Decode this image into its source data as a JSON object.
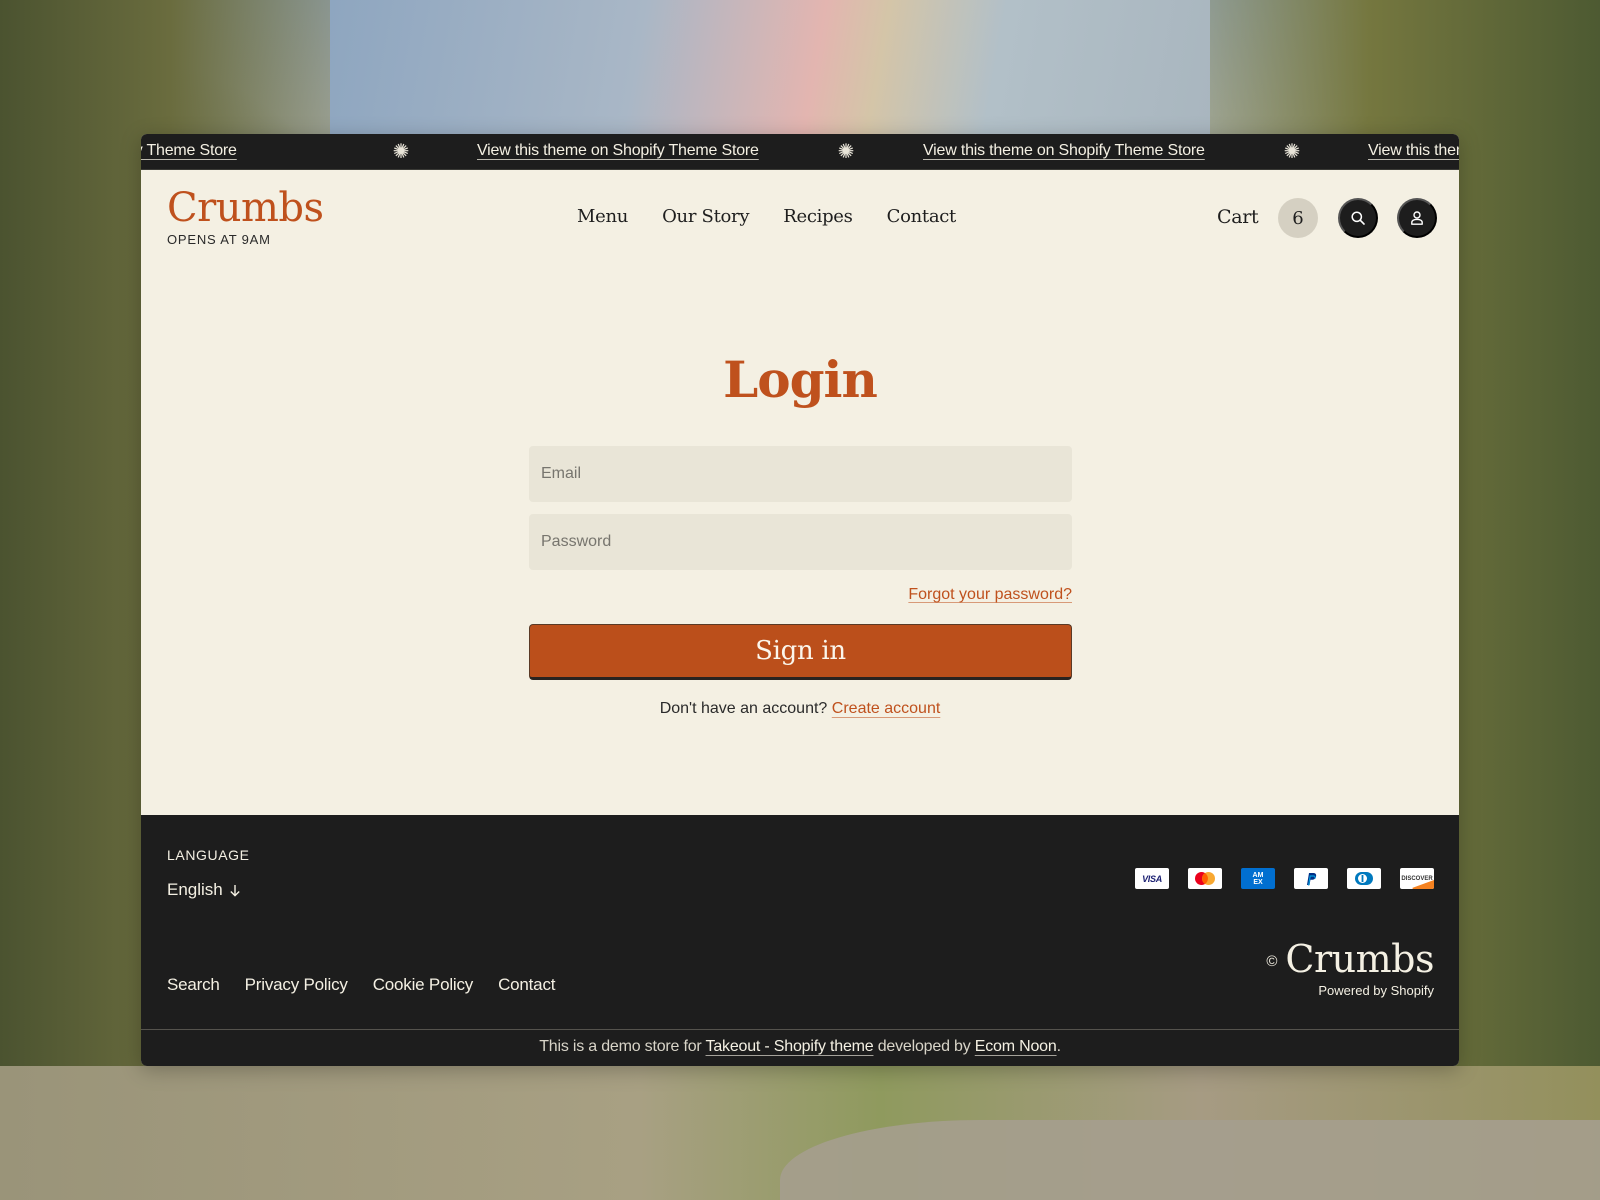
{
  "announcement": {
    "items": [
      "View this theme on Shopify Theme Store",
      "View this theme on Shopify Theme Store",
      "View this theme on Shopify Theme Store",
      "View this theme on Shopify Theme Store"
    ],
    "separator_icon": "sparkle-icon"
  },
  "header": {
    "logo": "Crumbs",
    "tagline": "OPENS AT 9AM",
    "nav": [
      "Menu",
      "Our Story",
      "Recipes",
      "Contact"
    ],
    "cart_label": "Cart",
    "cart_count": "6",
    "search_icon": "search-icon",
    "account_icon": "user-icon"
  },
  "login": {
    "title": "Login",
    "email_placeholder": "Email",
    "password_placeholder": "Password",
    "forgot_link": "Forgot your password?",
    "submit_label": "Sign in",
    "no_account_text": "Don't have an account?",
    "create_link": "Create account"
  },
  "footer": {
    "language_label": "LANGUAGE",
    "language_value": "English",
    "payment_methods": [
      "Visa",
      "Mastercard",
      "American Express",
      "PayPal",
      "Diners Club",
      "Discover"
    ],
    "brand": "Crumbs",
    "copyright_symbol": "©",
    "powered_by": "Powered by Shopify",
    "links": [
      "Search",
      "Privacy Policy",
      "Cookie Policy",
      "Contact"
    ],
    "demo_note": {
      "prefix": "This is a demo store for ",
      "theme_link": "Takeout - Shopify theme",
      "middle": " developed by ",
      "dev_link": "Ecom Noon",
      "suffix": "."
    }
  },
  "colors": {
    "accent": "#bf511d",
    "button": "#bb4f1b",
    "page_bg": "#f4f0e3",
    "dark": "#1d1d1d",
    "input_bg": "#e9e5d7"
  }
}
